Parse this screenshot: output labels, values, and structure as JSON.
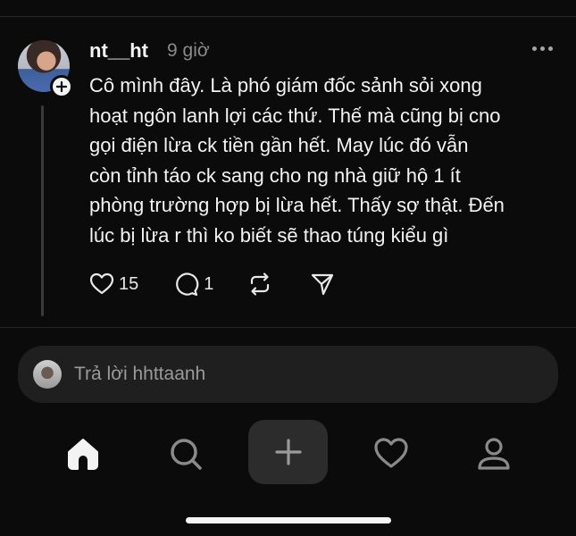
{
  "post": {
    "username": "nt__ht",
    "timestamp": "9 giờ",
    "text": "Cô mình đây. Là phó giám đốc sảnh sỏi xong\nhoạt ngôn lanh lợi các thứ. Thế mà cũng bị cno\ngọi điện lừa ck tiền gần hết. May lúc đó vẫn\ncòn tỉnh táo ck sang cho ng nhà giữ hộ 1 ít\nphòng trường hợp bị lừa hết. Thấy sợ thật. Đến\nlúc bị lừa r thì ko biết sẽ thao túng kiểu gì",
    "likes": "15",
    "replies": "1"
  },
  "reply": {
    "placeholder": "Trả lời hhttaanh"
  },
  "icons": {
    "like": "heart-icon",
    "comment": "comment-icon",
    "repost": "repost-icon",
    "share": "send-icon",
    "more": "more-icon",
    "home": "home-icon",
    "search": "search-icon",
    "compose": "plus-icon",
    "activity": "heart-icon",
    "profile": "profile-icon"
  },
  "colors": {
    "background": "#0b0b0b",
    "text": "#f3f3f3",
    "muted": "#8a8a8a",
    "reply_box": "#1f1f1f"
  }
}
